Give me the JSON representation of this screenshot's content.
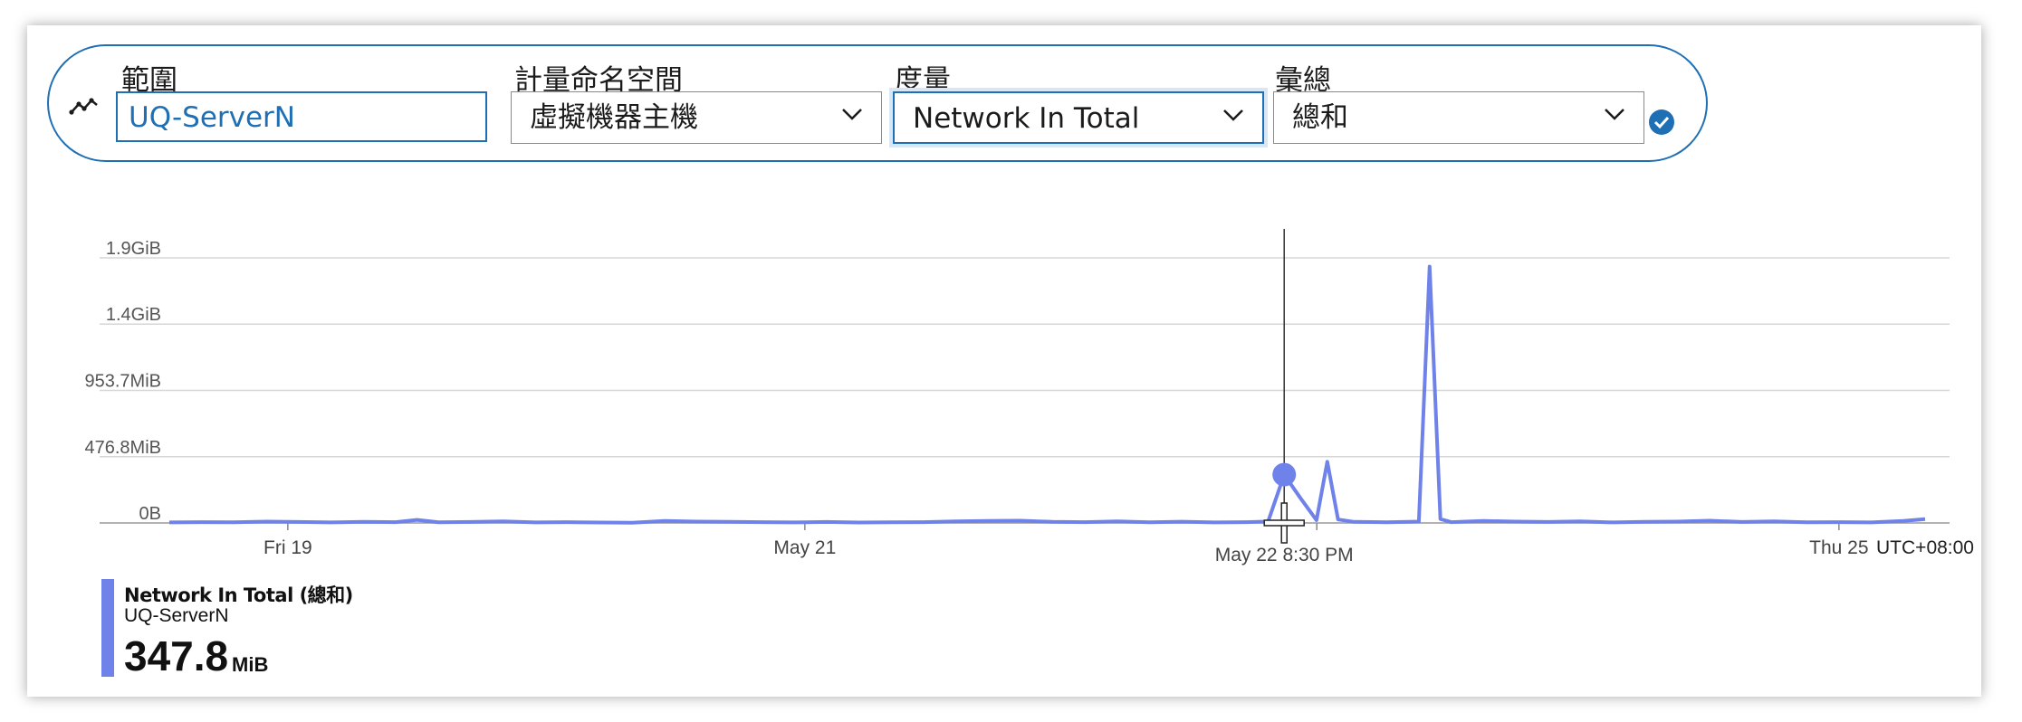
{
  "toolbar": {
    "scope_label": "範圍",
    "scope_value": "UQ-ServerN",
    "namespace_label": "計量命名空間",
    "namespace_value": "虛擬機器主機",
    "metric_label": "度量",
    "metric_value": "Network In Total",
    "aggregation_label": "彙總",
    "aggregation_value": "總和",
    "accent_color": "#1f6fb4"
  },
  "chart_data": {
    "type": "line",
    "y_ticks": [
      "1.9GiB",
      "1.4GiB",
      "953.7MiB",
      "476.8MiB",
      "0B"
    ],
    "y_tick_values_mib": [
      1907.3,
      1430.5,
      953.7,
      476.8,
      0
    ],
    "x_ticks": [
      "Fri 19",
      "May 21",
      "Thu 25"
    ],
    "x_tick_hours": [
      0,
      48,
      144
    ],
    "cursor_label": "May 22 8:30 PM",
    "cursor_hour": 92.5,
    "timezone": "UTC+08:00",
    "ylim_mib": [
      0,
      1907.3
    ],
    "xlim_hours": [
      -11,
      152
    ],
    "series": [
      {
        "name": "Network In Total (總和)",
        "color": "#6f82ea",
        "hour": [
          -11,
          -8,
          -5,
          -2,
          1,
          4,
          7,
          10,
          12,
          14,
          17,
          20,
          23,
          26,
          29,
          32,
          35,
          38,
          41,
          44,
          47,
          50,
          53,
          56,
          59,
          62,
          65,
          68,
          71,
          74,
          77,
          80,
          83,
          86,
          89,
          91,
          92.5,
          94,
          95.5,
          96.5,
          97.5,
          99,
          102,
          105,
          106,
          107,
          108,
          111,
          114,
          117,
          120,
          123,
          126,
          129,
          132,
          135,
          138,
          141,
          144,
          147,
          150,
          152
        ],
        "values_mib": [
          4,
          6,
          5,
          10,
          7,
          4,
          8,
          6,
          22,
          5,
          7,
          12,
          4,
          6,
          3,
          1,
          14,
          10,
          8,
          6,
          4,
          7,
          3,
          5,
          6,
          12,
          15,
          16,
          8,
          6,
          12,
          5,
          9,
          4,
          6,
          10,
          347.8,
          180,
          20,
          440,
          25,
          8,
          5,
          10,
          1845,
          28,
          6,
          14,
          10,
          7,
          12,
          4,
          8,
          10,
          16,
          7,
          12,
          5,
          6,
          4,
          14,
          28
        ]
      }
    ]
  },
  "legend": {
    "series_name": "Network In Total (總和)",
    "resource": "UQ-ServerN",
    "value": "347.8",
    "unit": "MiB"
  }
}
